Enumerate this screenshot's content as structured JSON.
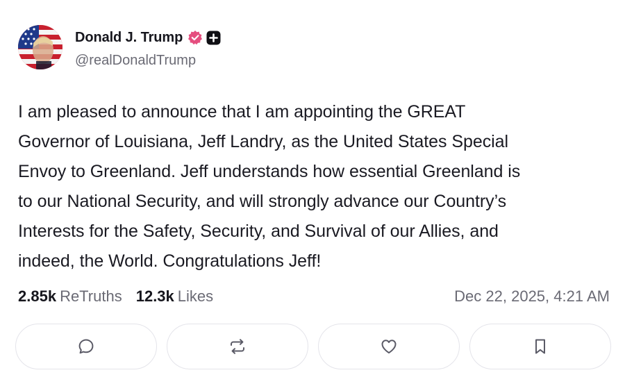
{
  "author": {
    "display_name": "Donald J. Trump",
    "handle": "@realDonaldTrump",
    "verified_badge_color": "#e54e7f",
    "plus_badge_color": "#0f0f14"
  },
  "post": {
    "text": "I am pleased to announce that I am appointing the GREAT\nGovernor of Louisiana, Jeff Landry, as the United States Special\nEnvoy to Greenland. Jeff understands how essential Greenland is\nto our National Security, and will strongly advance our Country’s\nInterests for the Safety, Security, and Survival of our Allies, and\nindeed, the World. Congratulations Jeff!",
    "retruths_count": "2.85k",
    "retruths_label": "ReTruths",
    "likes_count": "12.3k",
    "likes_label": "Likes",
    "timestamp": "Dec 22, 2025, 4:21 AM"
  },
  "actions": [
    {
      "name": "reply",
      "icon": "comment-icon"
    },
    {
      "name": "retruth",
      "icon": "retruth-icon"
    },
    {
      "name": "like",
      "icon": "heart-icon"
    },
    {
      "name": "bookmark",
      "icon": "bookmark-icon"
    }
  ]
}
